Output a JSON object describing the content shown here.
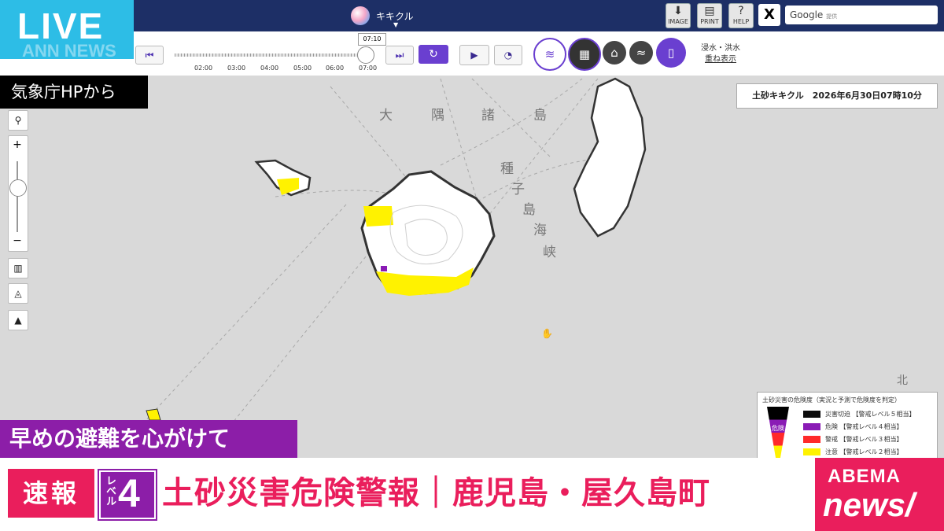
{
  "live_badge": {
    "text": "LIVE",
    "sub": "ANN NEWS"
  },
  "app": {
    "title": "キキクル",
    "caret": "▼"
  },
  "toolbar": {
    "image_label": "IMAGE",
    "print_label": "PRINT",
    "help_label": "HELP",
    "x_label": "X",
    "google_label": "Google",
    "google_sub": "提供"
  },
  "timeline": {
    "current_time": "07:10",
    "ticks": [
      "02:00",
      "03:00",
      "04:00",
      "05:00",
      "06:00",
      "07:00"
    ],
    "progress": 0.97
  },
  "overlay": {
    "line1": "浸水・洪水",
    "line2": "重ね表示"
  },
  "source_label": "気象庁HPから",
  "map": {
    "caption": "土砂キキクル　2026年6月30日07時10分",
    "labels": {
      "sea_osumi_1": "大",
      "sea_osumi_2": "隅",
      "sea_osumi_3": "諸",
      "sea_osumi_4": "島",
      "strait_1": "種",
      "strait_2": "子",
      "strait_3": "島",
      "strait_4": "海",
      "strait_5": "峡",
      "north": "北"
    },
    "controls": {
      "zoom_in": "+",
      "zoom_out": "−"
    }
  },
  "legend": {
    "title": "土砂災害の危険度（実況と予測で危険度を判定）",
    "cone_label": "危険",
    "rows": [
      {
        "name": "災害切迫",
        "level": "【警戒レベル５相当】",
        "color": "#0c0c0c"
      },
      {
        "name": "危険",
        "level": "【警戒レベル４相当】",
        "color": "#8a1bb5"
      },
      {
        "name": "警戒",
        "level": "【警戒レベル３相当】",
        "color": "#ff2a2a"
      },
      {
        "name": "注意",
        "level": "【警戒レベル２相当】",
        "color": "#fff200"
      }
    ]
  },
  "chyron": {
    "advice": "早めの避難を心がけて",
    "breaking": "速報",
    "level_word": "レベル",
    "level_num": "4",
    "headline": "土砂災害危険警報｜鹿児島・屋久島町"
  },
  "brand": {
    "top": "ABEMA",
    "bottom": "news/"
  },
  "colors": {
    "accent_pink": "#ea1e5c",
    "accent_purple": "#8c1ea8",
    "live_blue": "#2dbde6",
    "nav": "#1d2f66",
    "warn_yellow": "#fff200"
  }
}
